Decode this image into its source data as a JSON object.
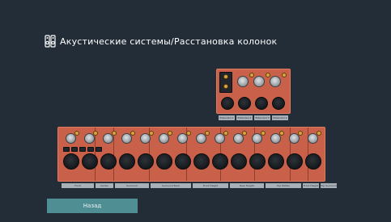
{
  "header": {
    "title": "Акустические системы/Расстановка колонок",
    "icon": "speaker-setup-icon"
  },
  "top_panel": {
    "labels": [
      "Extended 1",
      "Extended 2",
      "Extended 3",
      "Extended 4"
    ]
  },
  "bottom_panel": {
    "labels": [
      "Front",
      "Center",
      "Surround",
      "Surround Back",
      "Front Height",
      "Rear Height",
      "Top Middle",
      "Front Height",
      "Top Surround"
    ]
  },
  "footer": {
    "back_label": "Назад"
  },
  "colors": {
    "background": "#222d38",
    "panel": "#c9614a",
    "button": "#4f8f94"
  }
}
